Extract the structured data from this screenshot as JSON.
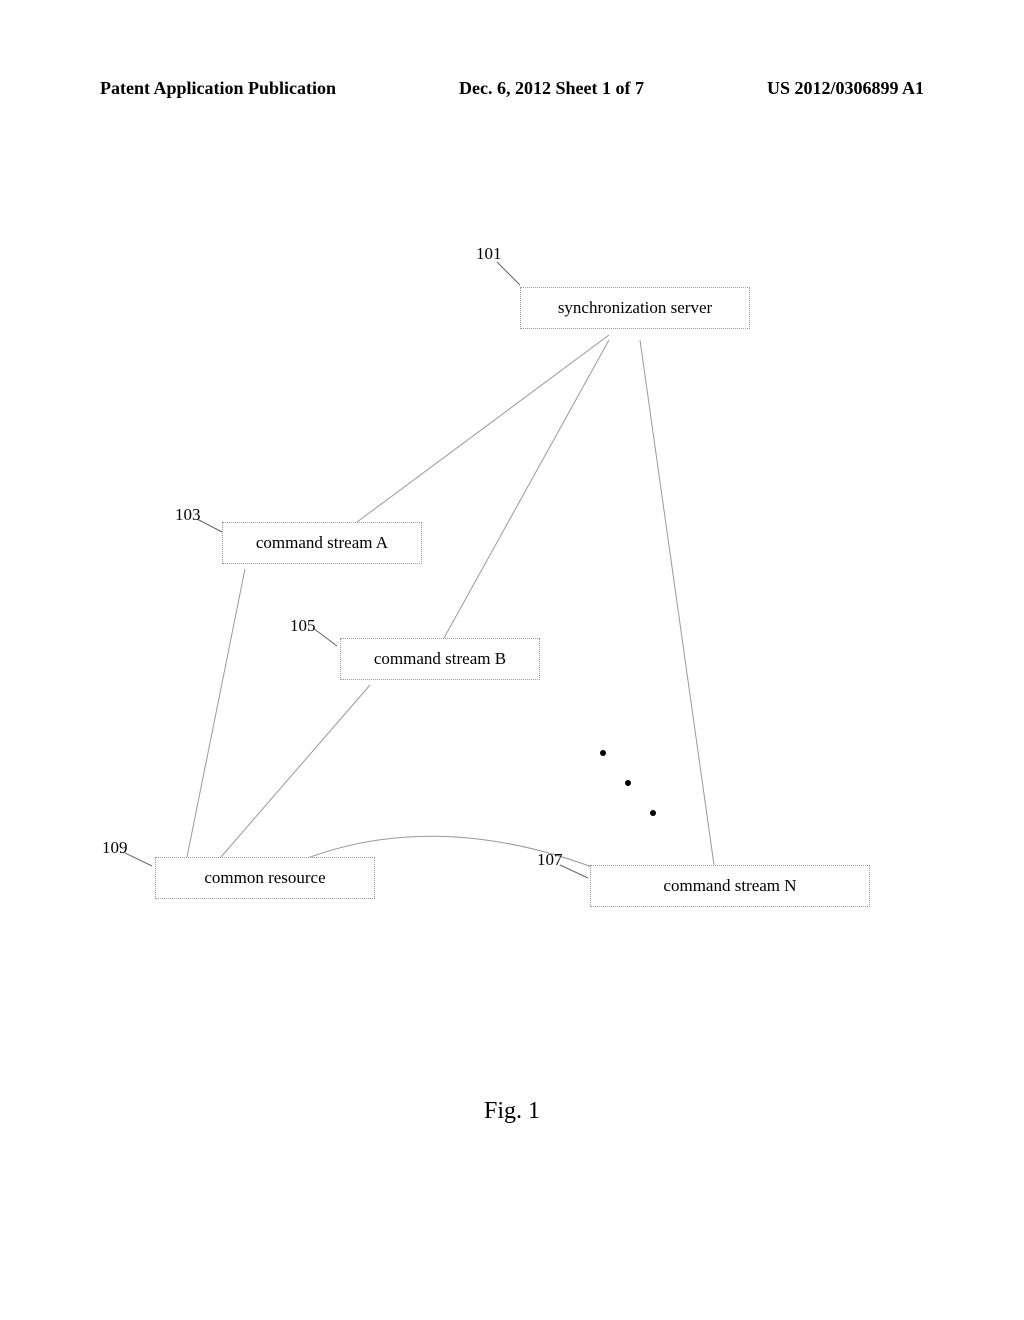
{
  "header": {
    "left": "Patent Application Publication",
    "center": "Dec. 6, 2012   Sheet 1 of 7",
    "right": "US 2012/0306899 A1"
  },
  "labels": {
    "101": "101",
    "103": "103",
    "105": "105",
    "107": "107",
    "109": "109"
  },
  "boxes": {
    "sync_server": "synchronization server",
    "stream_a": "command stream A",
    "stream_b": "command stream B",
    "stream_n": "command stream N",
    "common_resource": "common resource"
  },
  "figure": "Fig. 1"
}
